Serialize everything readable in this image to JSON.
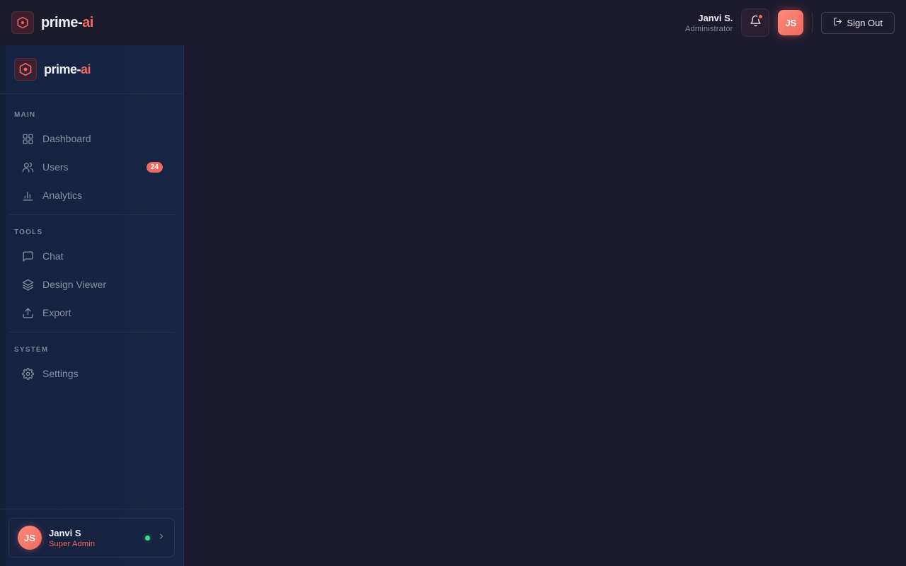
{
  "brand": {
    "name_main": "prime-",
    "name_accent": "ai"
  },
  "header": {
    "user_name": "Janvi S.",
    "user_role": "Administrator",
    "avatar_initials": "JS",
    "signout_label": "Sign Out",
    "notification_dot": true
  },
  "sidebar": {
    "sections": [
      {
        "label": "MAIN",
        "items": [
          {
            "label": "Dashboard",
            "icon": "grid-icon"
          },
          {
            "label": "Users",
            "icon": "users-icon",
            "badge": "24"
          },
          {
            "label": "Analytics",
            "icon": "bar-chart-icon"
          }
        ]
      },
      {
        "label": "TOOLS",
        "items": [
          {
            "label": "Chat",
            "icon": "chat-icon"
          },
          {
            "label": "Design Viewer",
            "icon": "layers-icon"
          },
          {
            "label": "Export",
            "icon": "upload-icon"
          }
        ]
      },
      {
        "label": "SYSTEM",
        "items": [
          {
            "label": "Settings",
            "icon": "gear-icon"
          }
        ]
      }
    ],
    "footer_user": {
      "initials": "JS",
      "name": "Janvi S",
      "role": "Super Admin",
      "status": "online"
    }
  },
  "colors": {
    "accent": "#f06a60",
    "background": "#1b1a2c",
    "sidebar": "#172443",
    "online": "#3ddc84"
  }
}
